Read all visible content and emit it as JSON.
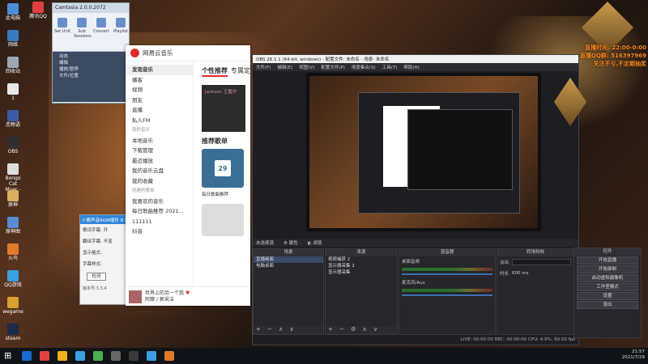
{
  "desktop": {
    "icons": [
      {
        "label": "此电脑",
        "color": "#4a8fd8"
      },
      {
        "label": "网络",
        "color": "#3a7ac0"
      },
      {
        "label": "回收站",
        "color": "#9aa8b8"
      },
      {
        "label": "1",
        "color": "#e8e8e8"
      },
      {
        "label": "恋物语",
        "color": "#3b5da8"
      },
      {
        "label": "OBS",
        "color": "#303030"
      },
      {
        "label": "Bongo Cat Mver - St",
        "color": "#ddd"
      },
      {
        "label": "原神",
        "color": "#d8b060"
      },
      {
        "label": "原神图",
        "color": "#5a8ad0"
      },
      {
        "label": "火鸟",
        "color": "#e07a2a"
      },
      {
        "label": "QQ游戏",
        "color": "#3aa0e0"
      },
      {
        "label": "wegame",
        "color": "#d8a030"
      },
      {
        "label": "steam",
        "color": "#1a2a4a"
      }
    ],
    "top_icon": {
      "label": "腾讯QQ",
      "color": "#e04040"
    }
  },
  "camtasia": {
    "title": "Camtasia 2.0.0.2072",
    "ribbon": [
      "Set Unit",
      "Sub Sessions",
      "Convert",
      "Playlist"
    ],
    "tree": [
      "动态",
      "编辑",
      "播放/暂停",
      "文件/位置"
    ]
  },
  "plugin": {
    "title": "小鹿声音RGM插件 8.5",
    "rows": [
      "歌词字幕: 开",
      "翻译字幕: 不显",
      "显示格式:",
      "字幕样式:"
    ],
    "button": "检测",
    "version": "版本号:3.3.4"
  },
  "music": {
    "app_name": "网易云音乐",
    "search_placeholder": "搜索",
    "sidebar": [
      {
        "label": "发现音乐",
        "active": true
      },
      {
        "label": "播客"
      },
      {
        "label": "视频"
      },
      {
        "label": "朋友"
      },
      {
        "label": "直播"
      },
      {
        "label": "私人FM"
      },
      {
        "label": "我的音乐",
        "section": true
      },
      {
        "label": "本地音乐"
      },
      {
        "label": "下载管理"
      },
      {
        "label": "最近播放"
      },
      {
        "label": "我的音乐云盘"
      },
      {
        "label": "我的收藏"
      },
      {
        "label": "创建的歌单",
        "section": true
      },
      {
        "label": "我喜欢的音乐"
      },
      {
        "label": "每日歌曲推荐 2021..."
      },
      {
        "label": "111111"
      },
      {
        "label": "抖音"
      }
    ],
    "tabs": [
      "个性推荐",
      "专属定制"
    ],
    "banner_text": "Jackson 王嘉尔",
    "section_title": "推荐歌单",
    "card_day": "29",
    "card_caption": "每日歌曲推荐",
    "now_playing": {
      "title": "世界上的另一个我",
      "artist": "阿肆 / 郭采洁"
    }
  },
  "obs": {
    "title": "OBS 26.1.1 (64-bit, windows) - 配置文件: 未命名 - 场景: 未命名",
    "menu": [
      "文件(F)",
      "编辑(E)",
      "视图(V)",
      "配置文件(P)",
      "场景集合(S)",
      "工具(T)",
      "帮助(H)"
    ],
    "dock_bar": [
      "未选择源",
      "属性",
      "滤镜"
    ],
    "scenes": {
      "header": "场景",
      "items": [
        "直播画面",
        "电脑桌面"
      ]
    },
    "sources": {
      "header": "来源",
      "items": [
        "视频捕获 2",
        "显示器采集 2",
        "显示器采集"
      ]
    },
    "mixer": {
      "header": "混音器",
      "channels": [
        "桌面音频",
        "麦克风/Aux"
      ]
    },
    "transitions": {
      "header": "转场特效",
      "type": "淡出",
      "duration_label": "时长",
      "duration": "600 ms"
    },
    "controls": {
      "header": "控件",
      "buttons": [
        "开始直播",
        "开始录制",
        "启动虚拟摄像机",
        "工作室模式",
        "设置",
        "退出"
      ]
    },
    "status": "LIVE: 00:00:00   REC: 00:00:00   CPU: 4.9%, 60.00 fps"
  },
  "overlay": {
    "line1": "直播时间: 22:00-0:00",
    "line2": "直播QQ群: 516397969",
    "line3": "关注不亏,不定期抽奖"
  },
  "taskbar": {
    "icons": [
      "#1a6ad0",
      "#e04040",
      "#f0b020",
      "#3aa0e0",
      "#4caf50",
      "#666",
      "#3a3a3a",
      "#3aa0e0",
      "#e07a2a"
    ],
    "time": "21:57",
    "date": "2021/7/29"
  }
}
